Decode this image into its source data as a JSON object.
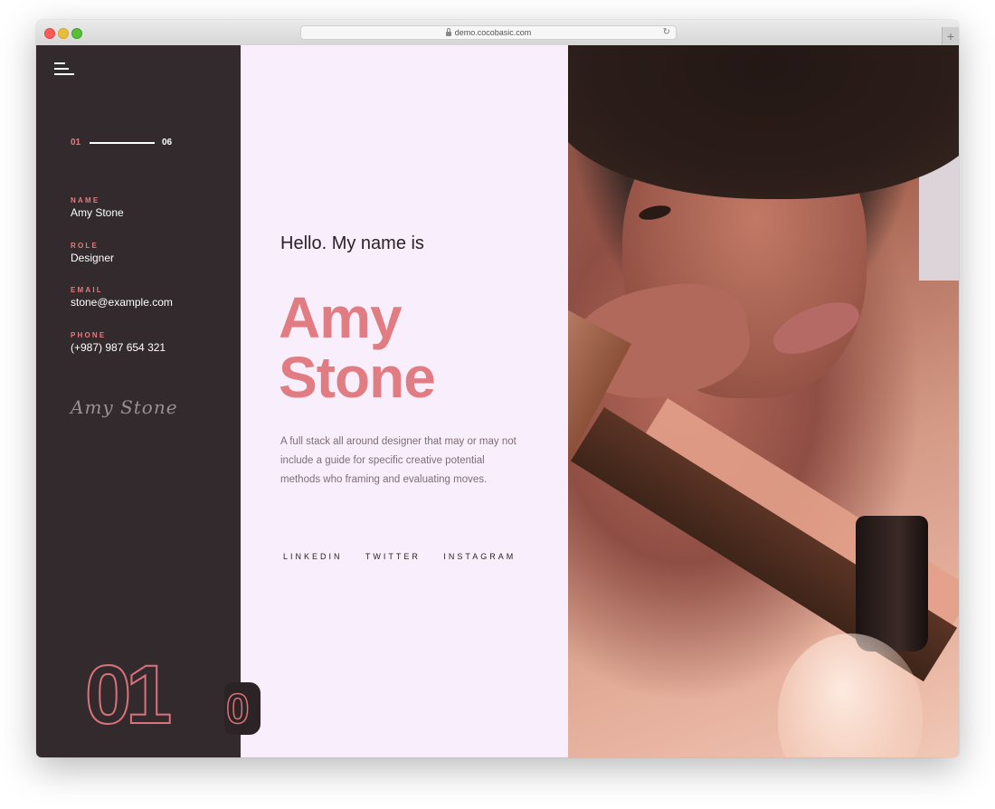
{
  "browser": {
    "url": "demo.cocobasic.com"
  },
  "sidebar": {
    "pager": {
      "current": "01",
      "total": "06"
    },
    "info": [
      {
        "label": "NAME",
        "value": "Amy Stone"
      },
      {
        "label": "ROLE",
        "value": "Designer"
      },
      {
        "label": "EMAIL",
        "value": "stone@example.com"
      },
      {
        "label": "PHONE",
        "value": "(+987) 987 654 321"
      }
    ],
    "signature": "Amy Stone",
    "big_number": "01",
    "next_digit": "0"
  },
  "hero": {
    "greeting": "Hello. My name is",
    "first_name": "Amy",
    "last_name": "Stone",
    "description": "A full stack all around designer that may or may not include a guide for specific creative potential methods who framing and evaluating moves.",
    "social": [
      "LINKEDIN",
      "TWITTER",
      "INSTAGRAM"
    ]
  },
  "colors": {
    "accent": "#e07c82",
    "sidebar_bg": "#332a2d",
    "middle_bg": "#f9eefb"
  }
}
